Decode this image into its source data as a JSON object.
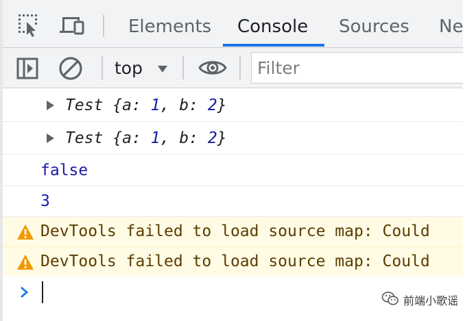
{
  "tabs": [
    {
      "label": "Elements",
      "active": false
    },
    {
      "label": "Console",
      "active": true
    },
    {
      "label": "Sources",
      "active": false
    },
    {
      "label": "Ne",
      "active": false
    }
  ],
  "toolbar": {
    "context": "top",
    "filter_placeholder": "Filter"
  },
  "icons": {
    "inspect": "inspect-element-icon",
    "device": "device-toolbar-icon",
    "sidebar": "console-sidebar-icon",
    "clear": "clear-console-icon",
    "eye": "live-expression-eye-icon",
    "warning": "warning-icon",
    "prompt": "prompt-chevron-icon",
    "wechat": "wechat-logo-icon"
  },
  "console": {
    "objects": [
      {
        "name": "Test",
        "open": "{",
        "k1": "a:",
        "v1": "1",
        "sep": ",",
        "k2": "b:",
        "v2": "2",
        "close": "}"
      },
      {
        "name": "Test",
        "open": "{",
        "k1": "a:",
        "v1": "1",
        "sep": ",",
        "k2": "b:",
        "v2": "2",
        "close": "}"
      }
    ],
    "values": [
      "false",
      "3"
    ],
    "warnings": [
      "DevTools failed to load source map: Could",
      "DevTools failed to load source map: Could"
    ]
  },
  "watermark": {
    "text": "前端小歌谣"
  },
  "colors": {
    "accent": "#1a73e8",
    "value_blue": "#1a1aa6",
    "warning_bg": "#fffbe5",
    "warning_icon": "#f29900"
  }
}
